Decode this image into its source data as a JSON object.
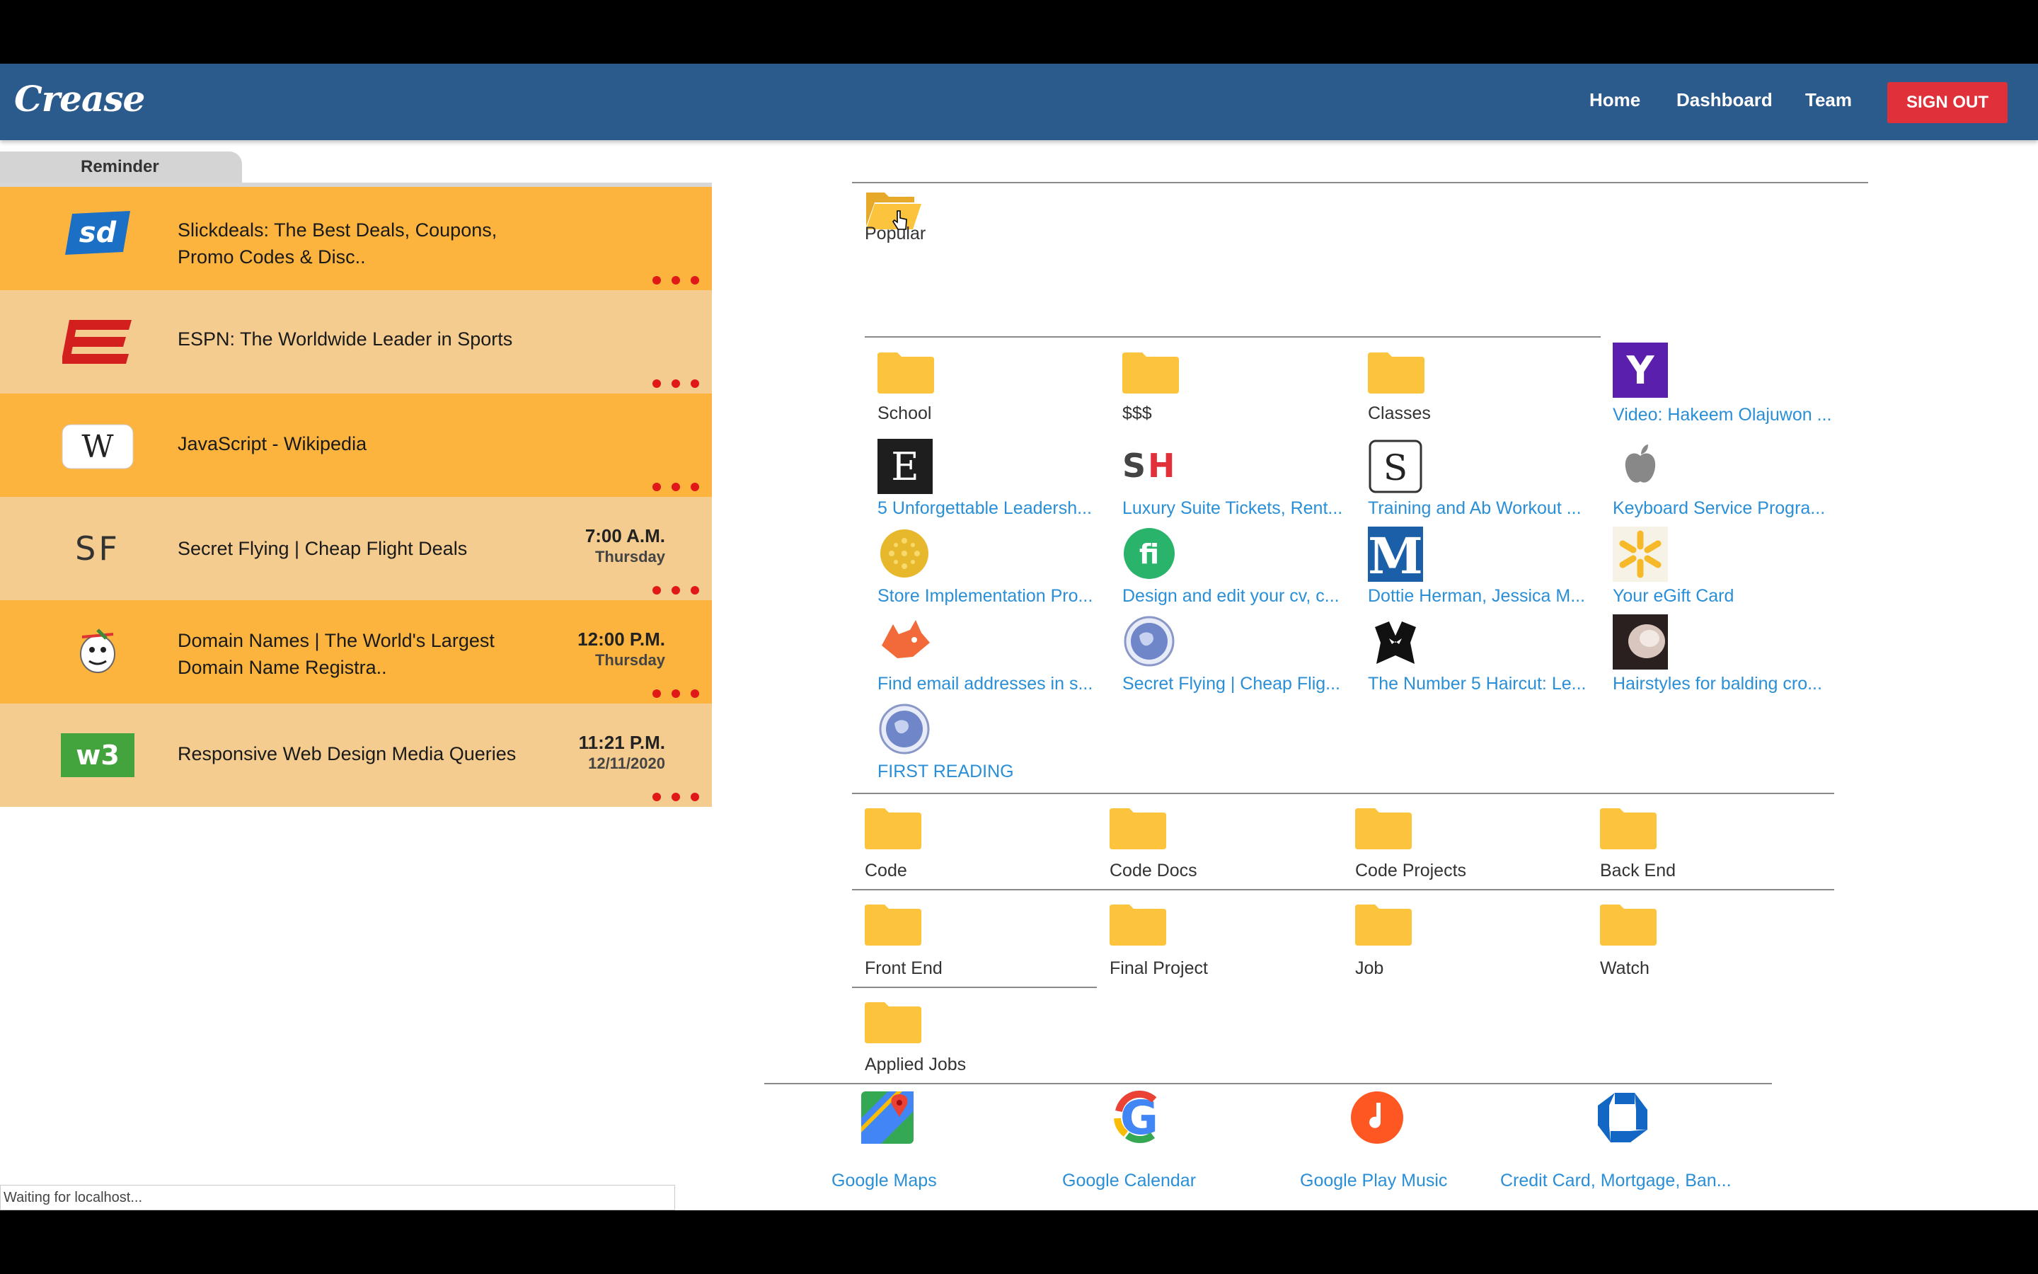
{
  "brand": "Crease",
  "nav": {
    "home": "Home",
    "dashboard": "Dashboard",
    "team": "Team",
    "signout": "SIGN OUT"
  },
  "reminder": {
    "tab_label": "Reminder",
    "items": [
      {
        "title": "Slickdeals: The Best Deals, Coupons, Promo Codes & Disc..",
        "time": "",
        "day": "",
        "icon": "slickdeals-icon"
      },
      {
        "title": "ESPN: The Worldwide Leader in Sports",
        "time": "",
        "day": "",
        "icon": "espn-icon"
      },
      {
        "title": "JavaScript - Wikipedia",
        "time": "",
        "day": "",
        "icon": "wikipedia-icon"
      },
      {
        "title": "Secret Flying | Cheap Flight Deals",
        "time": "7:00 A.M.",
        "day": "Thursday",
        "icon": "secret-flying-icon"
      },
      {
        "title": "Domain Names | The World's Largest Domain Name Registra..",
        "time": "12:00 P.M.",
        "day": "Thursday",
        "icon": "godaddy-icon"
      },
      {
        "title": "Responsive Web Design Media Queries",
        "time": "11:21 P.M.",
        "day": "12/11/2020",
        "icon": "w3schools-icon"
      }
    ]
  },
  "popular": {
    "label": "Popular",
    "folders": [
      "School",
      "$$$",
      "Classes"
    ],
    "links": [
      "Video: Hakeem Olajuwon ...",
      "5 Unforgettable Leadersh...",
      "Luxury Suite Tickets, Rent...",
      "Training and Ab Workout ...",
      "Keyboard Service Progra...",
      "Store Implementation Pro...",
      "Design and edit your cv, c...",
      "Dottie Herman, Jessica M...",
      "Your eGift Card",
      "Find email addresses in s...",
      "Secret Flying | Cheap Flig...",
      "The Number 5 Haircut: Le...",
      "Hairstyles for balding cro...",
      "FIRST READING"
    ]
  },
  "folders": [
    "Code",
    "Code Docs",
    "Code Projects",
    "Back End",
    "Front End",
    "Final Project",
    "Job",
    "Watch",
    "Applied Jobs"
  ],
  "apps": [
    "Google Maps",
    "Google Calendar",
    "Google Play Music",
    "Credit Card, Mortgage, Ban..."
  ],
  "status_bar": "Waiting for localhost...",
  "colors": {
    "navbar": "#2b5a8c",
    "signout": "#e0303a",
    "reminder_dark": "#fcb43e",
    "reminder_light": "#f4cc8f",
    "link": "#2a8fd6",
    "folder": "#fcc43c"
  }
}
